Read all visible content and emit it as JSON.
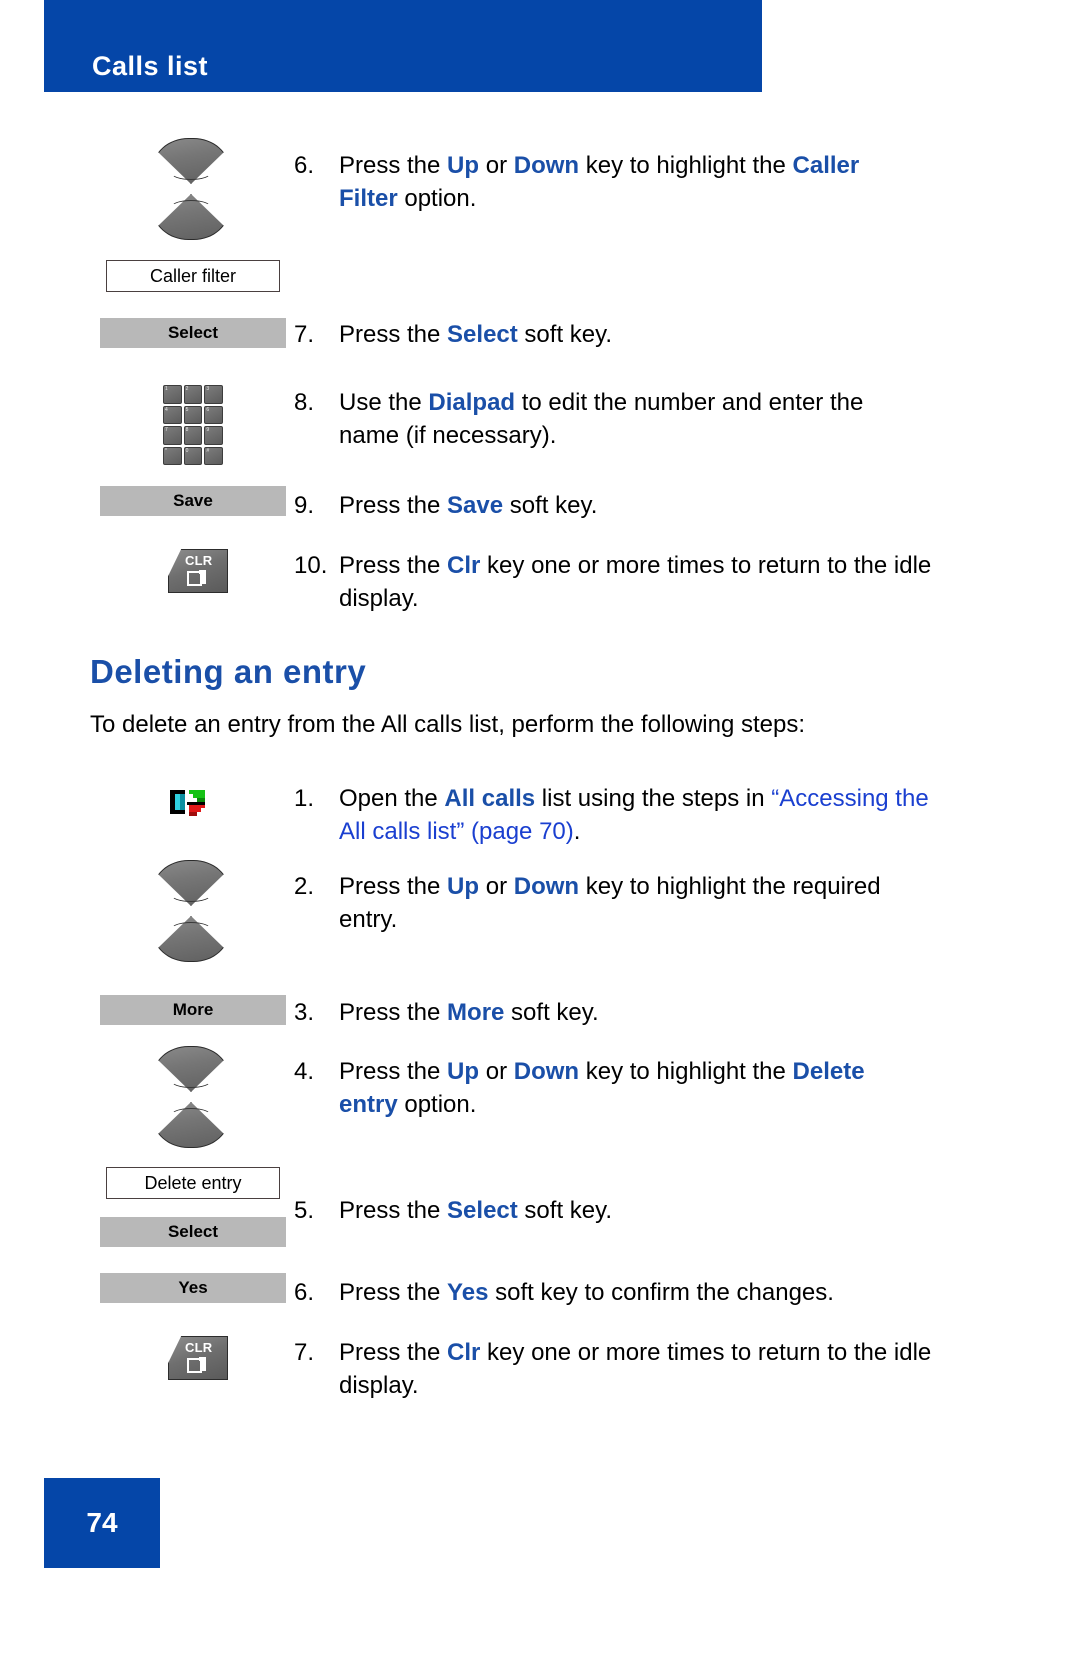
{
  "page": {
    "header_title": "Calls list",
    "page_number": "74",
    "accent_blue": "#0546a8",
    "link_blue": "#1a3fd0",
    "bold_blue": "#1a4fa8",
    "softkey_gray": "#b8b8b8"
  },
  "section_top": {
    "steps": [
      {
        "num": "6.",
        "icon": "up-down-navigation-key-icon",
        "option_box": "Caller filter",
        "parts": [
          {
            "t": "Press the ",
            "s": "plain"
          },
          {
            "t": "Up",
            "s": "bold"
          },
          {
            "t": " or ",
            "s": "plain"
          },
          {
            "t": "Down",
            "s": "bold"
          },
          {
            "t": " key to highlight the ",
            "s": "plain"
          },
          {
            "t": "Caller Filter",
            "s": "bold"
          },
          {
            "t": " option.",
            "s": "plain"
          }
        ]
      },
      {
        "num": "7.",
        "icon": "softkey-select",
        "softkey": "Select",
        "parts": [
          {
            "t": "Press the ",
            "s": "plain"
          },
          {
            "t": "Select",
            "s": "bold"
          },
          {
            "t": " soft key.",
            "s": "plain"
          }
        ]
      },
      {
        "num": "8.",
        "icon": "dialpad-icon",
        "parts": [
          {
            "t": "Use the ",
            "s": "plain"
          },
          {
            "t": "Dialpad",
            "s": "bold"
          },
          {
            "t": " to edit the number and enter the name (if necessary).",
            "s": "plain"
          }
        ]
      },
      {
        "num": "9.",
        "icon": "softkey-save",
        "softkey": "Save",
        "parts": [
          {
            "t": "Press the ",
            "s": "plain"
          },
          {
            "t": "Save",
            "s": "bold"
          },
          {
            "t": " soft key.",
            "s": "plain"
          }
        ]
      },
      {
        "num": "10.",
        "icon": "clr-key-icon",
        "parts": [
          {
            "t": "Press the ",
            "s": "plain"
          },
          {
            "t": "Clr",
            "s": "bold"
          },
          {
            "t": " key one or more times to return to the idle display.",
            "s": "plain"
          }
        ]
      }
    ]
  },
  "section_delete": {
    "heading": "Deleting an entry",
    "intro": "To delete an entry from the All calls list, perform the following steps:",
    "steps": [
      {
        "num": "1.",
        "icon": "calls-list-icon",
        "parts": [
          {
            "t": "Open the ",
            "s": "plain"
          },
          {
            "t": "All calls",
            "s": "bold"
          },
          {
            "t": " list using the steps in ",
            "s": "plain"
          },
          {
            "t": "“Accessing the All calls list” (page 70)",
            "s": "link"
          },
          {
            "t": ".",
            "s": "plain"
          }
        ]
      },
      {
        "num": "2.",
        "icon": "up-down-navigation-key-icon",
        "parts": [
          {
            "t": "Press the ",
            "s": "plain"
          },
          {
            "t": "Up",
            "s": "bold"
          },
          {
            "t": " or ",
            "s": "plain"
          },
          {
            "t": "Down",
            "s": "bold"
          },
          {
            "t": " key to highlight the required entry.",
            "s": "plain"
          }
        ]
      },
      {
        "num": "3.",
        "icon": "softkey-more",
        "softkey": "More",
        "parts": [
          {
            "t": "Press the ",
            "s": "plain"
          },
          {
            "t": "More",
            "s": "bold"
          },
          {
            "t": " soft key.",
            "s": "plain"
          }
        ]
      },
      {
        "num": "4.",
        "icon": "up-down-navigation-key-icon",
        "option_box": "Delete entry",
        "parts": [
          {
            "t": "Press the ",
            "s": "plain"
          },
          {
            "t": "Up",
            "s": "bold"
          },
          {
            "t": " or ",
            "s": "plain"
          },
          {
            "t": "Down",
            "s": "bold"
          },
          {
            "t": " key to highlight the ",
            "s": "plain"
          },
          {
            "t": "Delete entry",
            "s": "bold"
          },
          {
            "t": " option.",
            "s": "plain"
          }
        ]
      },
      {
        "num": "5.",
        "icon": "softkey-select",
        "softkey": "Select",
        "parts": [
          {
            "t": "Press the ",
            "s": "plain"
          },
          {
            "t": "Select",
            "s": "bold"
          },
          {
            "t": " soft key.",
            "s": "plain"
          }
        ]
      },
      {
        "num": "6.",
        "icon": "softkey-yes",
        "softkey": "Yes",
        "parts": [
          {
            "t": "Press the ",
            "s": "plain"
          },
          {
            "t": "Yes",
            "s": "bold"
          },
          {
            "t": " soft key to confirm the changes.",
            "s": "plain"
          }
        ]
      },
      {
        "num": "7.",
        "icon": "clr-key-icon",
        "parts": [
          {
            "t": "Press the ",
            "s": "plain"
          },
          {
            "t": "Clr",
            "s": "bold"
          },
          {
            "t": " key one or more times to return to the idle display.",
            "s": "plain"
          }
        ]
      }
    ]
  },
  "dialpad_keys": [
    "1",
    "2",
    "3",
    "4",
    "5",
    "6",
    "7",
    "8",
    "9",
    "*",
    "0",
    "#"
  ],
  "clr_key": {
    "label": "CLR"
  }
}
